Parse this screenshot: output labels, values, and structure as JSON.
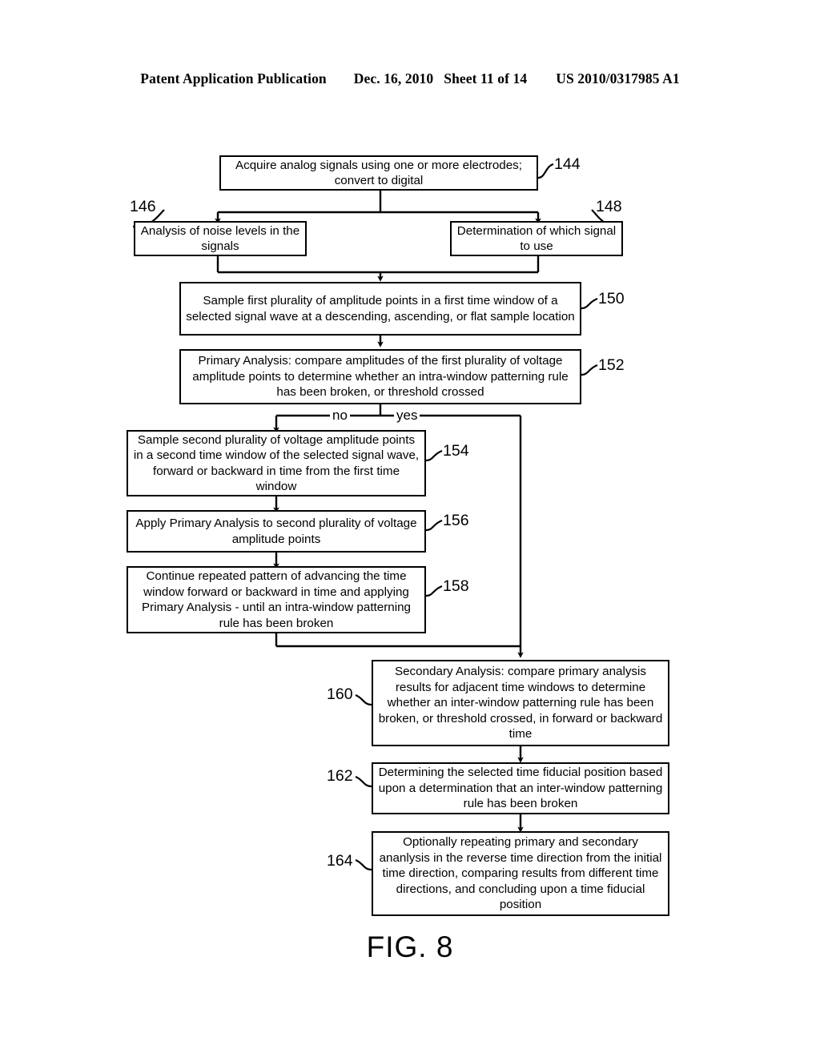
{
  "header": {
    "publication": "Patent Application Publication",
    "date": "Dec. 16, 2010",
    "sheet": "Sheet 11 of 14",
    "patent_number": "US 2010/0317985 A1"
  },
  "figure": {
    "caption": "FIG. 8",
    "branch_labels": {
      "no": "no",
      "yes": "yes"
    },
    "boxes": [
      {
        "ref": "144",
        "text": "Acquire analog signals using one or more electrodes; convert to digital"
      },
      {
        "ref": "146",
        "text": "Analysis of noise levels in the signals"
      },
      {
        "ref": "148",
        "text": "Determination of which signal to use"
      },
      {
        "ref": "150",
        "text": "Sample first plurality of amplitude points in a first time window of a selected signal wave at a descending, ascending, or flat sample location"
      },
      {
        "ref": "152",
        "text": "Primary Analysis: compare amplitudes of the first plurality of voltage amplitude points to determine whether an intra-window patterning rule has been broken, or threshold crossed"
      },
      {
        "ref": "154",
        "text": "Sample second plurality of voltage amplitude points in a second time window of the selected signal wave, forward or backward in time from the first time window"
      },
      {
        "ref": "156",
        "text": "Apply Primary Analysis to second plurality of voltage amplitude points"
      },
      {
        "ref": "158",
        "text": "Continue repeated pattern of advancing the time window forward or backward in time and applying Primary Analysis - until an intra-window patterning rule has been broken"
      },
      {
        "ref": "160",
        "text": "Secondary Analysis: compare primary analysis results for adjacent time windows to determine whether an inter-window patterning rule has been broken, or threshold crossed, in forward or backward time"
      },
      {
        "ref": "162",
        "text": "Determining the selected time fiducial position based upon a determination that an inter-window patterning rule has been broken"
      },
      {
        "ref": "164",
        "text": "Optionally repeating primary and secondary ananlysis in the reverse time direction from the initial time direction, comparing results from different time directions, and concluding upon a time fiducial position"
      }
    ]
  }
}
